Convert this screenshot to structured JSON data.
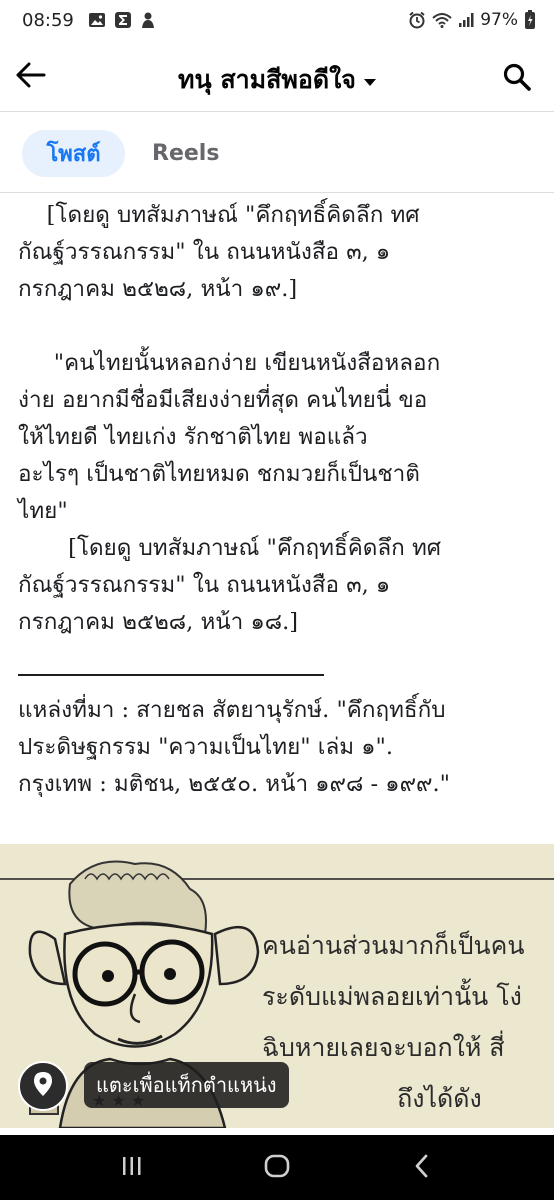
{
  "status_bar": {
    "time": "08:59",
    "battery": "97%",
    "left_icons": [
      "gallery-icon",
      "sigma-icon",
      "app-icon"
    ],
    "right_icons": [
      "alarm-icon",
      "wifi-icon",
      "signal-icon",
      "battery-icon"
    ]
  },
  "header": {
    "title": "ทนุ สามสีพอดีใจ",
    "back_icon": "arrow-left-icon",
    "search_icon": "search-icon"
  },
  "tabs": [
    {
      "label": "โพสต์",
      "active": true
    },
    {
      "label": "Reels",
      "active": false
    }
  ],
  "post": {
    "lines_1": [
      "    [โดยดู บทสัมภาษณ์ \"คึกฤทธิ์คิดลึก ทศ",
      "กัณฐ์วรรณกรรม\" ใน ถนนหนังสือ ๓, ๑",
      "กรกฎาคม ๒๕๒๘, หน้า ๑๙.]"
    ],
    "lines_2": [
      "     \"คนไทยนั้นหลอกง่าย เขียนหนังสือหลอก",
      "ง่าย อยากมีชื่อมีเสียงง่ายที่สุด คนไทยนี่ ขอ",
      "ให้ไทยดี ไทยเก่ง รักชาติไทย พอแล้ว",
      "อะไรๆ เป็นชาติไทยหมด ชกมวยก็เป็นชาติ",
      "ไทย\"",
      "       [โดยดู บทสัมภาษณ์ \"คึกฤทธิ์คิดลึก ทศ",
      "กัณฐ์วรรณกรรม\" ใน ถนนหนังสือ ๓, ๑",
      "กรกฎาคม ๒๕๒๘, หน้า ๑๘.]"
    ],
    "lines_3": [
      "แหล่งที่มา : สายชล สัตยานุรักษ์. \"คึกฤทธิ์กับ",
      "ประดิษฐกรรม \"ความเป็นไทย\" เล่ม ๑\".",
      "กรุงเทพ : มติชน, ๒๕๕๐. หน้า ๑๙๘ - ๑๙๙.\""
    ]
  },
  "photo": {
    "scan_lines": [
      "คนอ่านส่วนมากก็เป็นคน",
      "ระดับแม่พลอยเท่านั้น โง่",
      "ฉิบหายเลยจะบอกให้   สี่",
      "                 ถึงได้ดัง"
    ],
    "location_prompt": "แตะเพื่อแท็กตำแหน่ง",
    "location_icon": "location-pin-icon"
  },
  "navbar": {
    "icons": [
      "recents-icon",
      "home-icon",
      "back-icon"
    ]
  },
  "colors": {
    "accent": "#1877f2",
    "tab_active_bg": "#e7f0fd",
    "muted": "#65676b"
  }
}
